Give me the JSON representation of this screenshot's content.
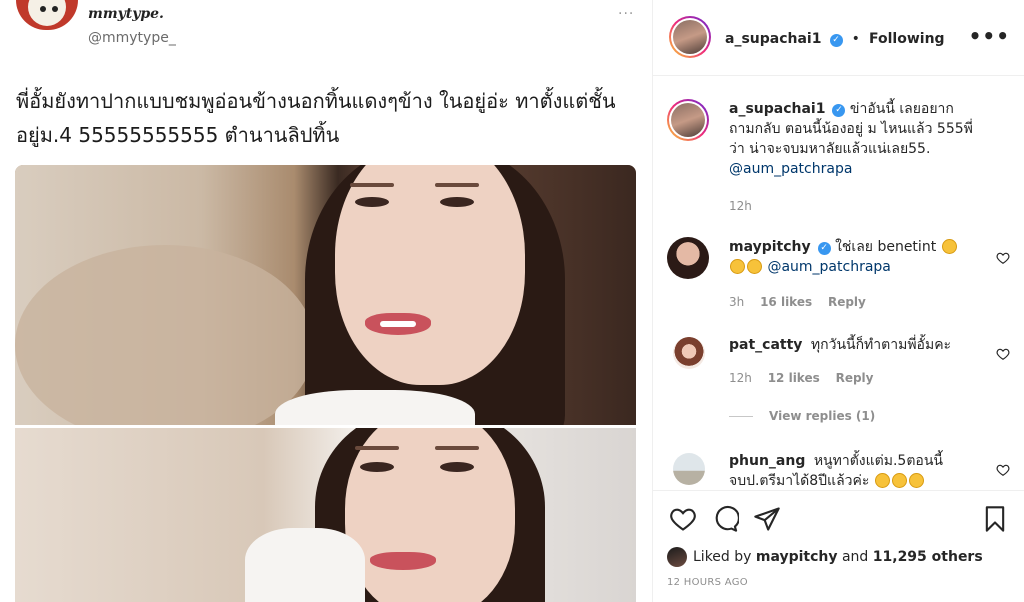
{
  "tweet": {
    "name": "mmytype.",
    "handle": "@mmytype_",
    "more": "···",
    "text": "พี่อั้มยังทาปากแบบชมพูอ่อนข้างนอกทิ้นแดงๆข้าง ในอยู่อ่ะ ทาตั้งแต่ชั้นอยู่ม.4 55555555555 ตำนานลิปทิ้น"
  },
  "header": {
    "username": "a_supachai1",
    "separator": "•",
    "follow_status": "Following",
    "more": "•••"
  },
  "comments": [
    {
      "username": "a_supachai1",
      "verified": true,
      "text": "ข่าอันนี้ เลยอยากถามกลับ ตอนนี้น้องอยู่ ม ไหนแล้ว 555พี่ว่า น่าจะจบมหาลัยแล้วแน่เลย55.",
      "mention": "@aum_patchrapa",
      "time": "12h"
    },
    {
      "username": "maypitchy",
      "verified": true,
      "text": "ใช่เลย benetint",
      "mention": "@aum_patchrapa",
      "time": "3h",
      "likes": "16 likes",
      "reply": "Reply"
    },
    {
      "username": "pat_catty",
      "verified": false,
      "text": "ทุกวันนี้ก็ทำตามพี่อั้มคะ",
      "time": "12h",
      "likes": "12 likes",
      "reply": "Reply",
      "view_replies": "View replies (1)"
    },
    {
      "username": "phun_ang",
      "verified": false,
      "text": "หนูทาตั้งแต่ม.5ตอนนี้จบป.ตรีมาได้8ปีแล้วค่ะ"
    }
  ],
  "likes": {
    "prefix": "Liked by",
    "user": "maypitchy",
    "conj": "and",
    "others": "11,295 others"
  },
  "time_ago": "12 HOURS AGO",
  "icons": [
    "heart-icon",
    "comment-icon",
    "share-icon",
    "bookmark-icon",
    "more-icon",
    "verified-icon"
  ],
  "colors": {
    "verified": "#3897f0",
    "mention": "#00376b",
    "muted": "#8e8e8e"
  }
}
